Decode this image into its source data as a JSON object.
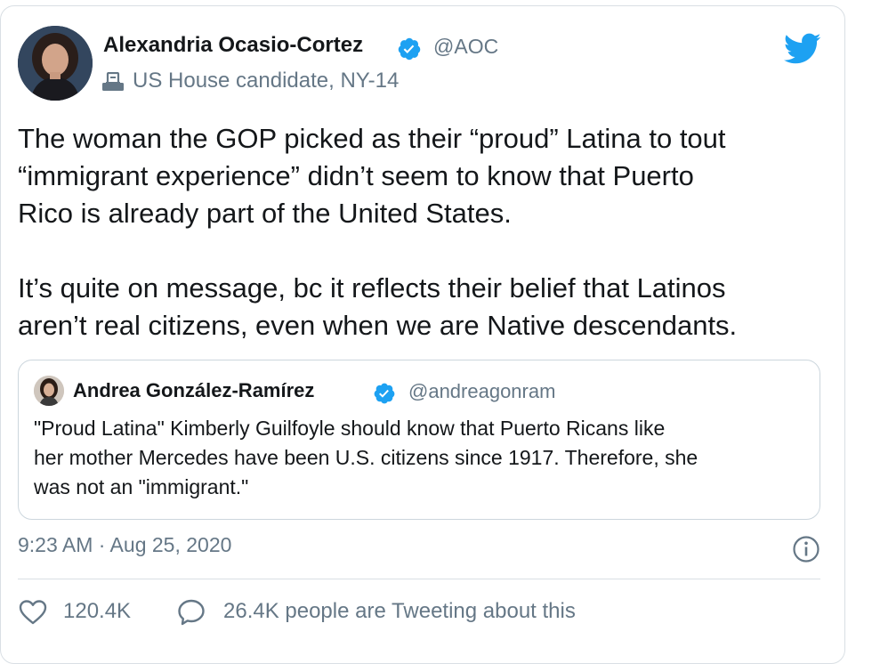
{
  "tweet": {
    "author": {
      "name": "Alexandria Ocasio-Cortez",
      "handle": "@AOC",
      "label": "US House candidate, NY-14",
      "label_icon": "ballot-box-icon",
      "verified": true
    },
    "text_lines": [
      "The woman the GOP picked as their “proud” Latina to tout",
      "“immigrant experience” didn’t seem to know that Puerto",
      "Rico is already part of the United States.",
      "It’s quite on message, bc it reflects their belief that Latinos",
      "aren’t real citizens, even when we are Native descendants."
    ],
    "timestamp": "9:23 AM · Aug 25, 2020",
    "likes": "120.4K",
    "tweeting_about": "26.4K people are Tweeting about this"
  },
  "quoted_tweet": {
    "name": "Andrea González-Ramírez",
    "handle": "@andreagonram",
    "verified": true,
    "text_lines": [
      "\"Proud Latina\" Kimberly Guilfoyle should know that Puerto Ricans like",
      "her mother Mercedes have been U.S. citizens since 1917. Therefore, she",
      "was not an \"immigrant.\""
    ]
  },
  "colors": {
    "brand_blue": "#1da1f2",
    "secondary_text": "#657786",
    "primary_text": "#14171a",
    "border": "#ccd6dd"
  }
}
